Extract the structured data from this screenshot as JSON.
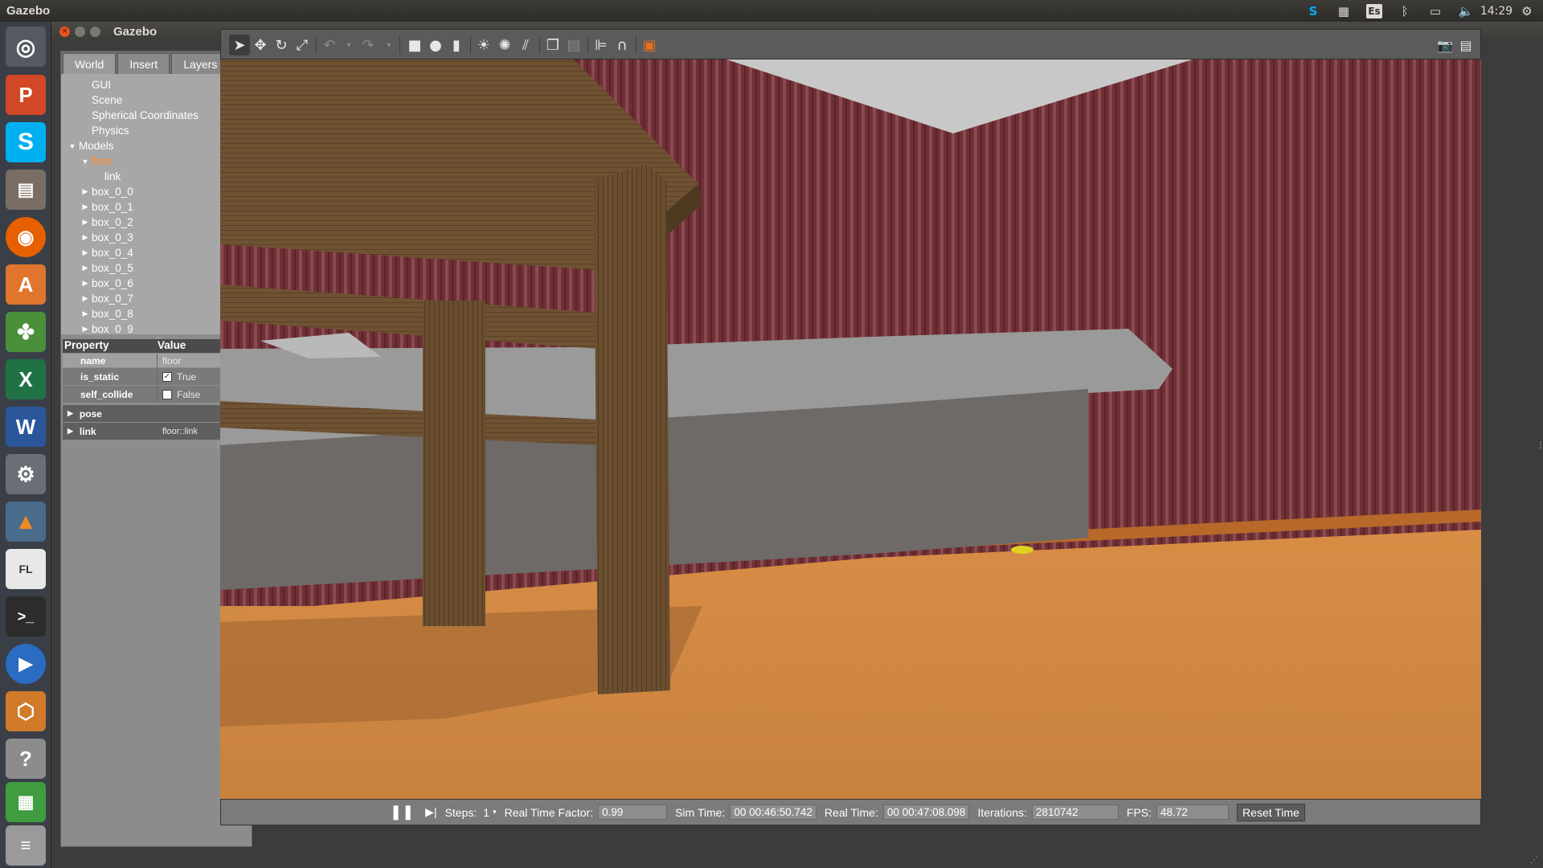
{
  "top_panel": {
    "app_name": "Gazebo",
    "keyboard_layout": "Es",
    "clock": "14:29"
  },
  "launcher": {
    "items": [
      "ubuntu-dash",
      "powerpoint",
      "skype",
      "file-manager",
      "firefox",
      "software-center",
      "pinwheel-app",
      "excel",
      "word",
      "system-settings",
      "matlab",
      "fl-studio",
      "terminal",
      "media-player",
      "virtualbox",
      "help",
      "spreadsheet-app",
      "stack-apps"
    ]
  },
  "window": {
    "title": "Gazebo"
  },
  "left_panel": {
    "tabs": [
      "World",
      "Insert",
      "Layers"
    ],
    "active_tab": "World",
    "tree": [
      {
        "label": "GUI",
        "level": 1,
        "arrow": ""
      },
      {
        "label": "Scene",
        "level": 1,
        "arrow": ""
      },
      {
        "label": "Spherical Coordinates",
        "level": 1,
        "arrow": ""
      },
      {
        "label": "Physics",
        "level": 1,
        "arrow": ""
      },
      {
        "label": "Models",
        "level": 0,
        "arrow": "open"
      },
      {
        "label": "floor",
        "level": 1,
        "arrow": "open",
        "selected": true
      },
      {
        "label": "link",
        "level": 2,
        "arrow": ""
      },
      {
        "label": "box_0_0",
        "level": 1,
        "arrow": "closed"
      },
      {
        "label": "box_0_1",
        "level": 1,
        "arrow": "closed"
      },
      {
        "label": "box_0_2",
        "level": 1,
        "arrow": "closed"
      },
      {
        "label": "box_0_3",
        "level": 1,
        "arrow": "closed"
      },
      {
        "label": "box_0_4",
        "level": 1,
        "arrow": "closed"
      },
      {
        "label": "box_0_5",
        "level": 1,
        "arrow": "closed"
      },
      {
        "label": "box_0_6",
        "level": 1,
        "arrow": "closed"
      },
      {
        "label": "box_0_7",
        "level": 1,
        "arrow": "closed"
      },
      {
        "label": "box_0_8",
        "level": 1,
        "arrow": "closed"
      },
      {
        "label": "box_0_9",
        "level": 1,
        "arrow": "closed"
      }
    ],
    "properties": {
      "header_property": "Property",
      "header_value": "Value",
      "name_label": "name",
      "name_value": "floor",
      "is_static_label": "is_static",
      "is_static_value": "True",
      "self_collide_label": "self_collide",
      "self_collide_value": "False",
      "pose_label": "pose",
      "link_label": "link",
      "link_value": "floor::link"
    }
  },
  "toolbar": {
    "tools": [
      "select-mode",
      "translate-mode",
      "rotate-mode",
      "scale-mode",
      "undo",
      "undo-history",
      "redo",
      "redo-history",
      "box-shape",
      "sphere-shape",
      "cylinder-shape",
      "point-light",
      "spot-light",
      "directional-light",
      "copy",
      "paste",
      "align",
      "snap",
      "change-view",
      "screenshot",
      "log"
    ]
  },
  "bottom_bar": {
    "steps_label": "Steps:",
    "steps_value": "1",
    "rtf_label": "Real Time Factor:",
    "rtf_value": "0.99",
    "sim_time_label": "Sim Time:",
    "sim_time_value": "00 00:46:50.742",
    "real_time_label": "Real Time:",
    "real_time_value": "00 00:47:08.098",
    "iterations_label": "Iterations:",
    "iterations_value": "2810742",
    "fps_label": "FPS:",
    "fps_value": "48.72",
    "reset_label": "Reset Time"
  },
  "colors": {
    "selected_item": "#ff8c2e",
    "close_button": "#e95420"
  }
}
